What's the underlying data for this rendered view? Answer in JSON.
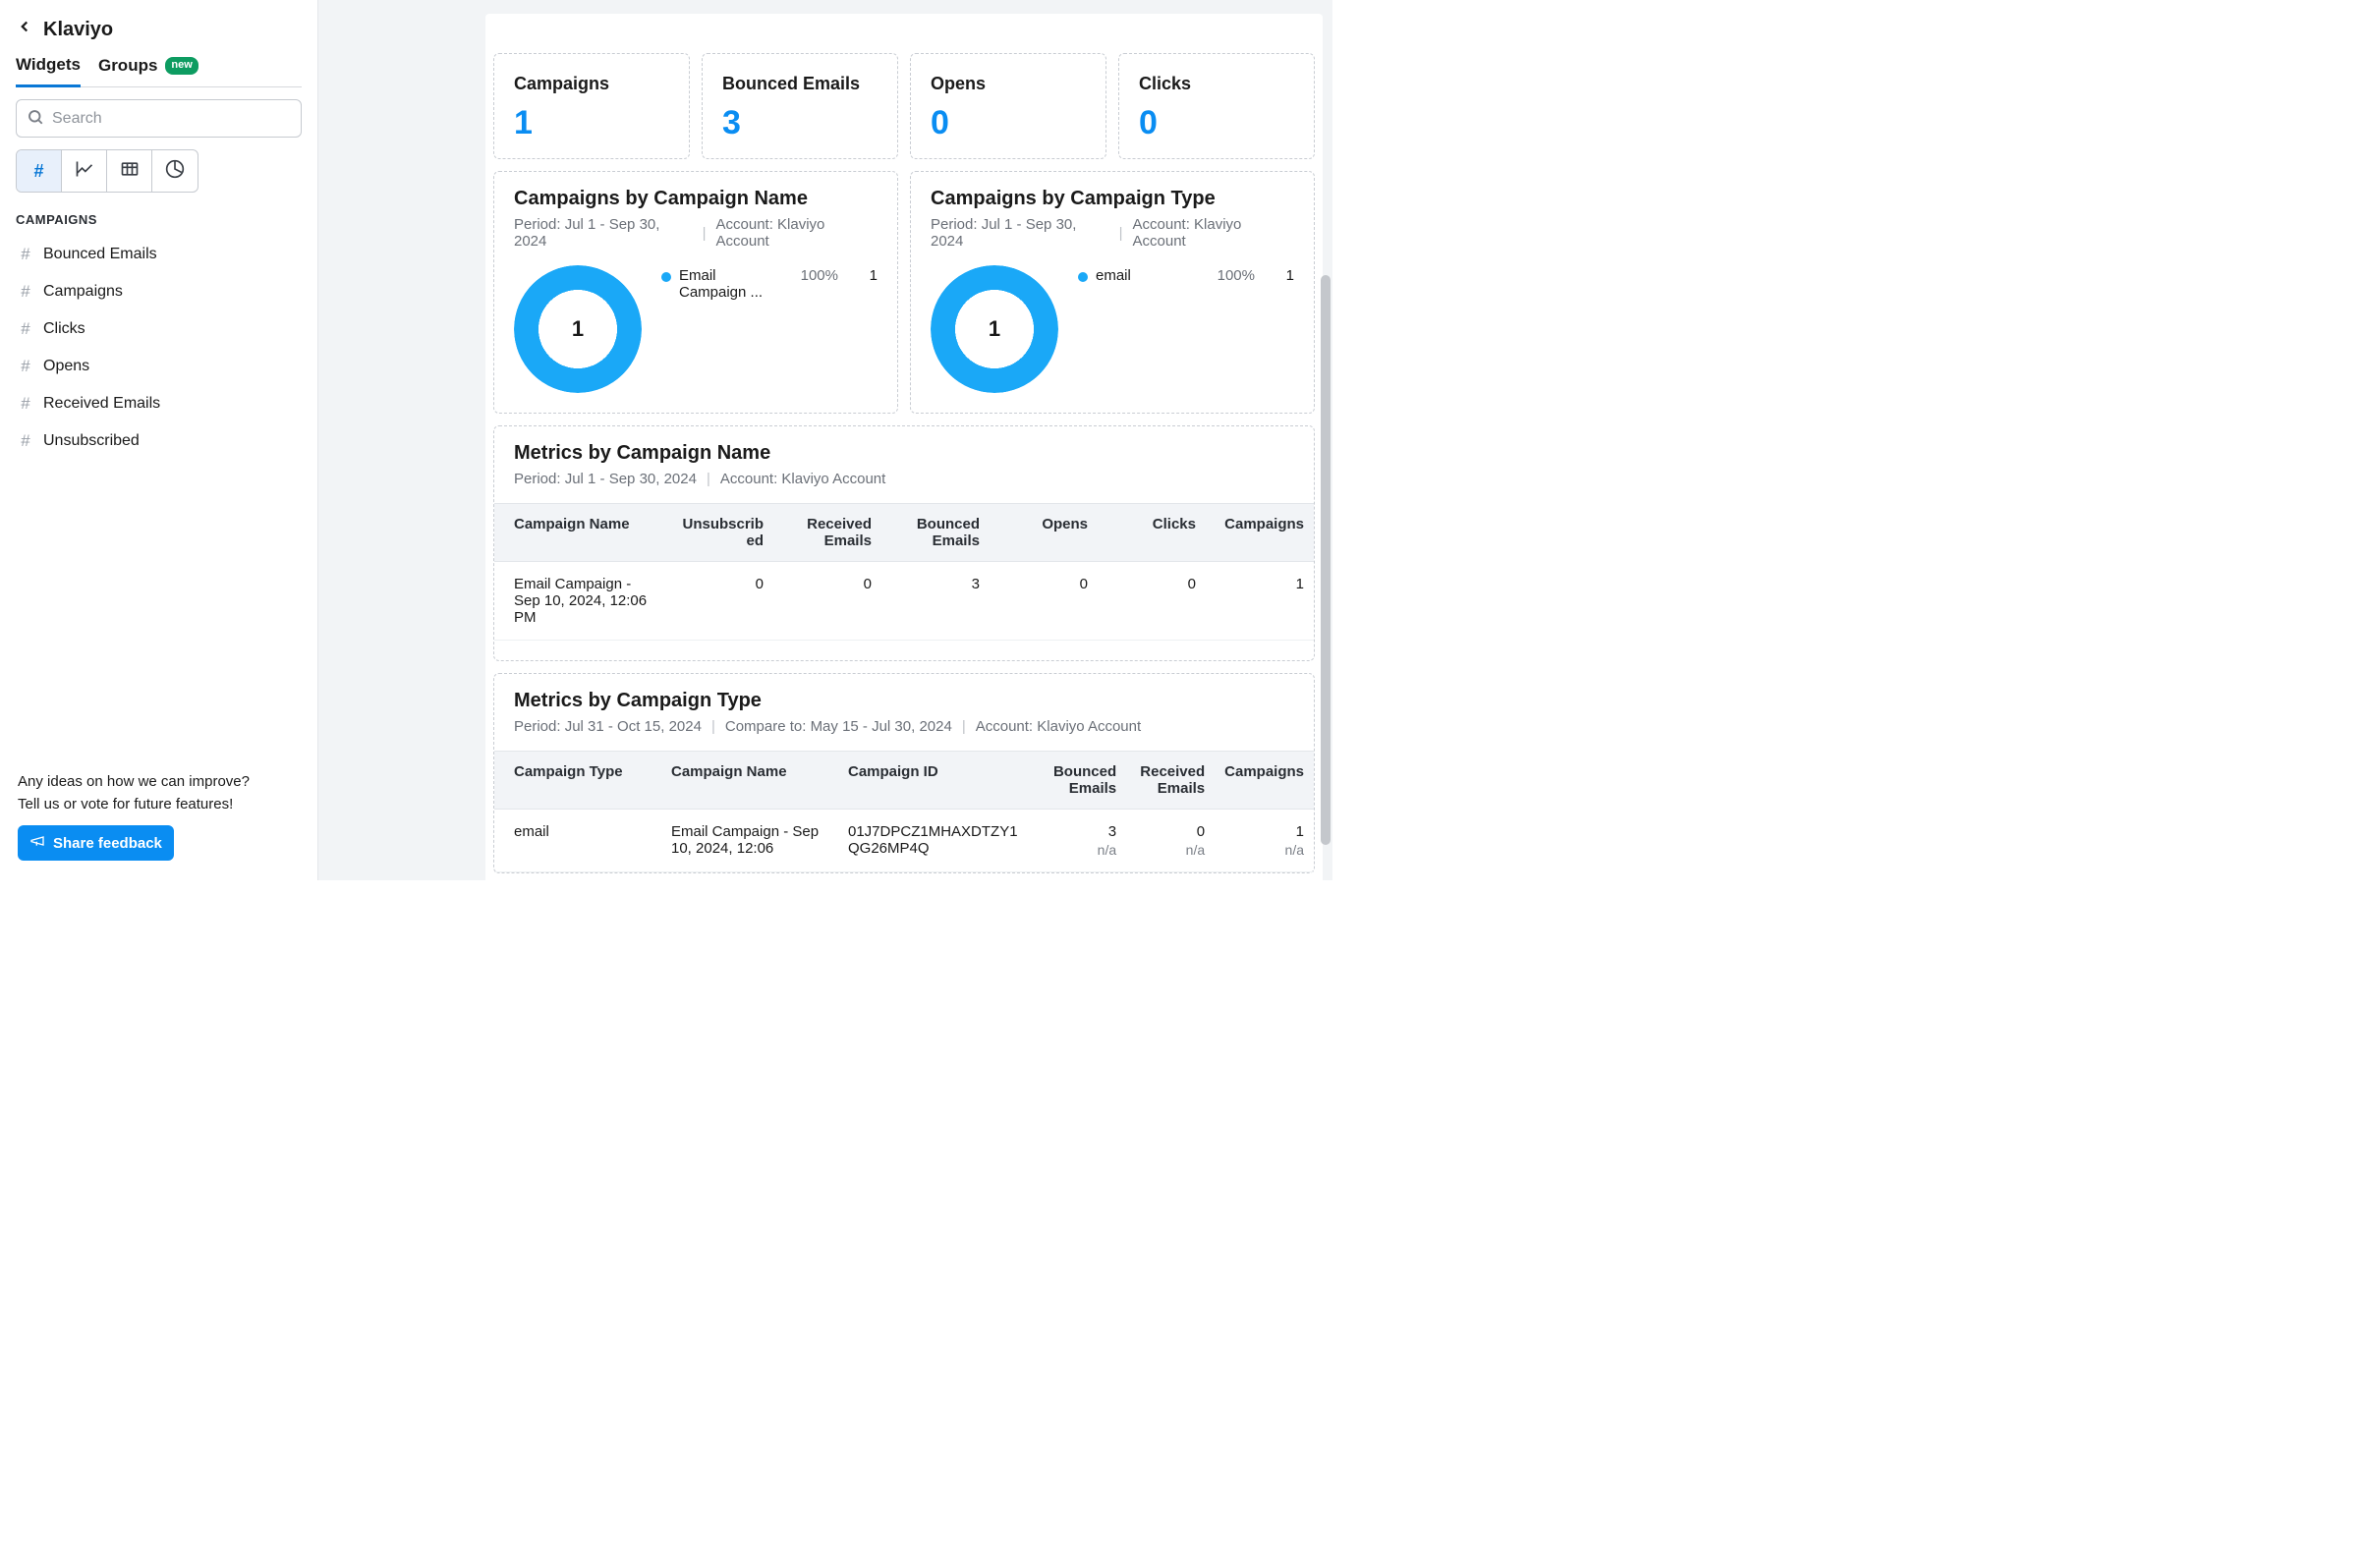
{
  "sidebar": {
    "title": "Klaviyo",
    "tabs": [
      {
        "label": "Widgets",
        "active": true
      },
      {
        "label": "Groups",
        "badge": "new"
      }
    ],
    "search_placeholder": "Search",
    "section_label": "CAMPAIGNS",
    "widgets": [
      {
        "label": "Bounced Emails"
      },
      {
        "label": "Campaigns"
      },
      {
        "label": "Clicks"
      },
      {
        "label": "Opens"
      },
      {
        "label": "Received Emails"
      },
      {
        "label": "Unsubscribed"
      }
    ]
  },
  "feedback": {
    "line1": "Any ideas on how we can improve?",
    "line2": "Tell us or vote for future features!",
    "button": "Share feedback"
  },
  "kpis": [
    {
      "title": "Campaigns",
      "value": "1"
    },
    {
      "title": "Bounced Emails",
      "value": "3"
    },
    {
      "title": "Opens",
      "value": "0"
    },
    {
      "title": "Clicks",
      "value": "0"
    }
  ],
  "donuts": [
    {
      "title": "Campaigns by Campaign Name",
      "period": "Period: Jul 1 - Sep 30, 2024",
      "account": "Account: Klaviyo Account",
      "center": "1",
      "legend_name": "Email Campaign ...",
      "legend_pct": "100%",
      "legend_val": "1"
    },
    {
      "title": "Campaigns by Campaign Type",
      "period": "Period: Jul 1 - Sep 30, 2024",
      "account": "Account: Klaviyo Account",
      "center": "1",
      "legend_name": "email",
      "legend_pct": "100%",
      "legend_val": "1"
    }
  ],
  "table1": {
    "title": "Metrics by Campaign Name",
    "period": "Period: Jul 1 - Sep 30, 2024",
    "account": "Account: Klaviyo Account",
    "headers": [
      "Campaign Name",
      "Unsubscribed",
      "Received Emails",
      "Bounced Emails",
      "Opens",
      "Clicks",
      "Campaigns"
    ],
    "rows": [
      {
        "name": "Email Campaign - Sep 10, 2024, 12:06 PM",
        "vals": [
          "0",
          "0",
          "3",
          "0",
          "0",
          "1"
        ]
      }
    ]
  },
  "table2": {
    "title": "Metrics by Campaign Type",
    "period": "Period: Jul 31 - Oct 15, 2024",
    "compare": "Compare to: May 15 - Jul 30, 2024",
    "account": "Account: Klaviyo Account",
    "headers": [
      "Campaign Type",
      "Campaign Name",
      "Campaign ID",
      "Bounced Emails",
      "Received Emails",
      "Campaigns"
    ],
    "rows": [
      {
        "type": "email",
        "name": "Email Campaign - Sep 10, 2024, 12:06",
        "id": "01J7DPCZ1MHAXDTZY1QG26MP4Q",
        "vals": [
          "3",
          "0",
          "1"
        ],
        "subs": [
          "n/a",
          "n/a",
          "n/a"
        ]
      }
    ]
  },
  "chart_data": [
    {
      "type": "pie",
      "title": "Campaigns by Campaign Name",
      "series": [
        {
          "name": "Email Campaign ...",
          "value": 1,
          "percent": 100
        }
      ],
      "total": 1
    },
    {
      "type": "pie",
      "title": "Campaigns by Campaign Type",
      "series": [
        {
          "name": "email",
          "value": 1,
          "percent": 100
        }
      ],
      "total": 1
    }
  ]
}
